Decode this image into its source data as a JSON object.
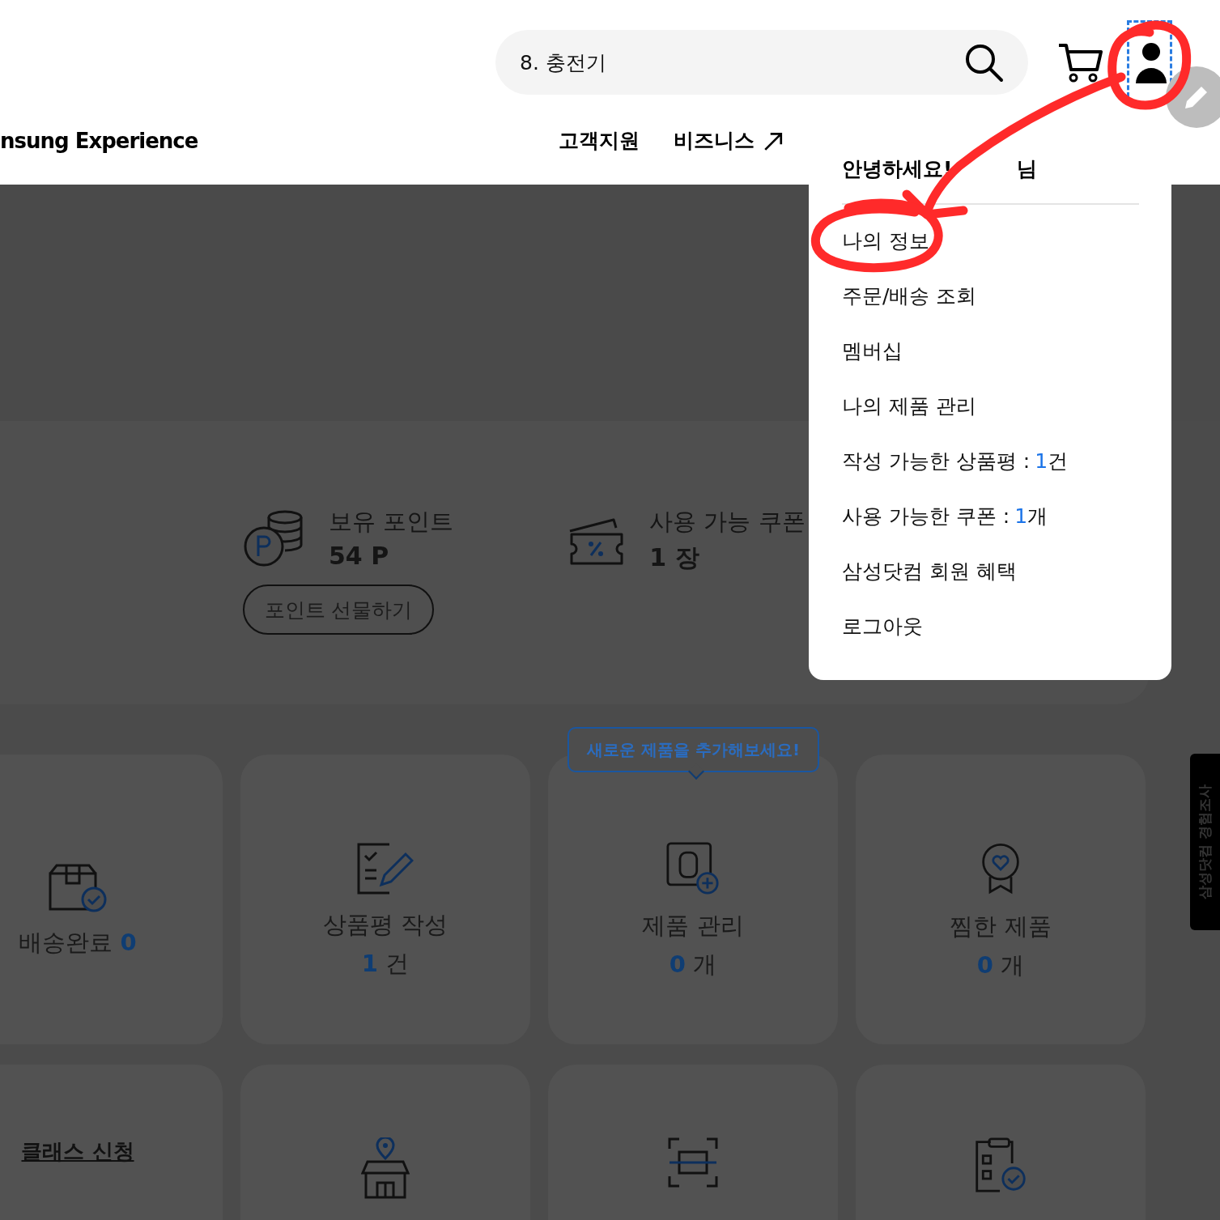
{
  "header": {
    "search": {
      "value": "8. 충전기"
    },
    "brand": "nsung Experience",
    "nav": [
      {
        "label": "고객지원",
        "external": false
      },
      {
        "label": "비즈니스",
        "external": true
      }
    ]
  },
  "user_menu": {
    "greeting": "안녕하세요!",
    "suffix": "님",
    "items": [
      {
        "label": "나의 정보"
      },
      {
        "label": "주문/배송 조회"
      },
      {
        "label": "멤버십"
      },
      {
        "label": "나의 제품 관리"
      },
      {
        "label": "작성 가능한 상품평 :",
        "count": "1",
        "unit": "건"
      },
      {
        "label": "사용 가능한 쿠폰 :",
        "count": "1",
        "unit": "개"
      },
      {
        "label": "삼성닷컴 회원 혜택"
      },
      {
        "label": "로그아웃"
      }
    ]
  },
  "points": {
    "label": "보유 포인트",
    "value": "54 P",
    "button": "포인트 선물하기"
  },
  "coupons": {
    "label": "사용 가능 쿠폰",
    "value": "1 장"
  },
  "tooltip": "새로운 제품을 추가해보세요!",
  "cards": [
    {
      "kind": "delivered",
      "label": "배송완료",
      "count": "0"
    },
    {
      "kind": "review",
      "label": "상품평 작성",
      "count": "1",
      "unit": "건"
    },
    {
      "kind": "product",
      "label": "제품 관리",
      "count": "0",
      "unit": "개"
    },
    {
      "kind": "wish",
      "label": "찜한 제품",
      "count": "0",
      "unit": "개"
    }
  ],
  "cards_row2": [
    {
      "kind": "class",
      "label": "클래스 신청"
    },
    {
      "kind": "store"
    },
    {
      "kind": "scan"
    },
    {
      "kind": "checklist"
    }
  ],
  "survey_tab": "삼성닷컴 경험조사"
}
